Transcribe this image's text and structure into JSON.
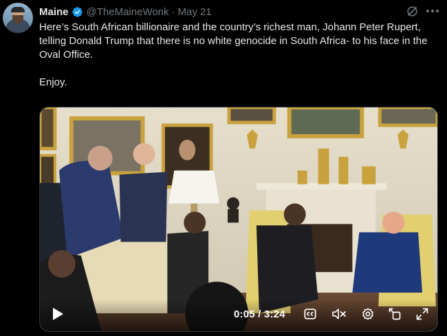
{
  "author": {
    "name": "Maine",
    "handle": "@TheMaineWonk",
    "separator": "·",
    "date": "May 21"
  },
  "tweet": {
    "text": "Here’s South African billionaire and the country’s richest man, Johann Peter Rupert, telling Donald Trump that there is no white genocide in South Africa- to his face in the Oval Office.\n\nEnjoy."
  },
  "video": {
    "time_current": "0:05",
    "time_separator": " / ",
    "time_total": "3:24",
    "progress": 0.025
  },
  "colors": {
    "background": "#000000",
    "text": "#e7e9ea",
    "muted": "#71767b",
    "verified": "#1d9bf0"
  },
  "icons": [
    "verified-badge-icon",
    "grok-icon",
    "more-icon",
    "play-icon",
    "captions-icon",
    "mute-icon",
    "settings-icon",
    "popout-icon",
    "fullscreen-icon"
  ]
}
